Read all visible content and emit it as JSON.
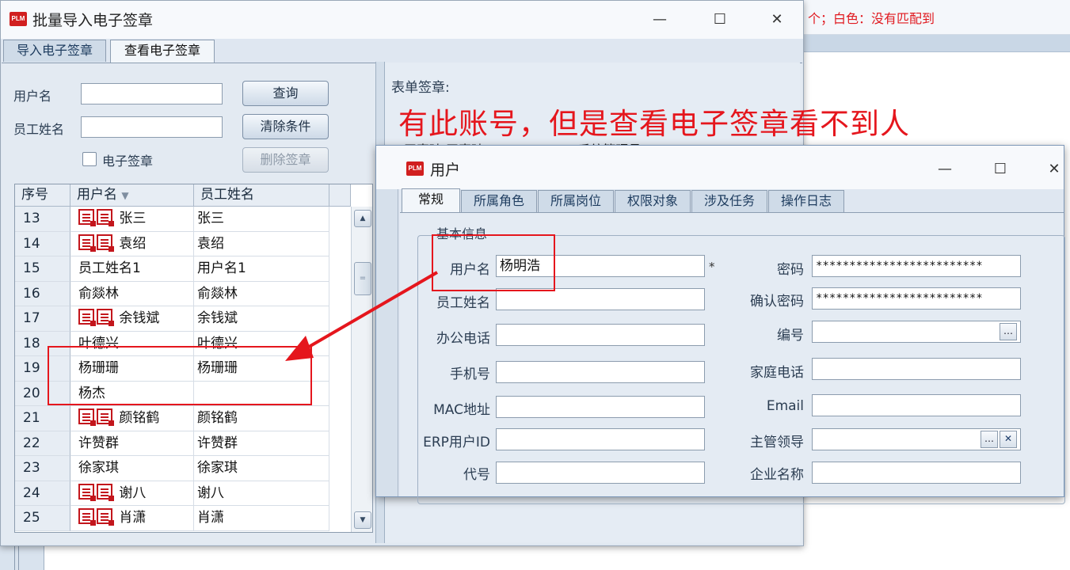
{
  "background": {
    "note": "个；白色：没有匹配到"
  },
  "main_window": {
    "title": "批量导入电子签章",
    "logo": "PLM",
    "controls": {
      "minimize": "—",
      "maximize": "☐",
      "close": "✕"
    },
    "tabs": [
      {
        "label": "导入电子签章",
        "active": false
      },
      {
        "label": "查看电子签章",
        "active": true
      }
    ],
    "filters": {
      "username_label": "用户名",
      "username_value": "",
      "employee_label": "员工姓名",
      "employee_value": "",
      "signature_checkbox_label": "电子签章"
    },
    "buttons": {
      "query": "查询",
      "clear": "清除条件",
      "delete": "删除签章"
    },
    "table": {
      "columns": [
        "序号",
        "用户名",
        "员工姓名"
      ],
      "sort_icon": "▼",
      "rows": [
        {
          "no": "13",
          "user": "张三",
          "name": "张三",
          "sig": true
        },
        {
          "no": "14",
          "user": "袁绍",
          "name": "袁绍",
          "sig": true
        },
        {
          "no": "15",
          "user": "员工姓名1",
          "name": "用户名1",
          "sig": false
        },
        {
          "no": "16",
          "user": "俞燚林",
          "name": "俞燚林",
          "sig": false
        },
        {
          "no": "17",
          "user": "余钱斌",
          "name": "余钱斌",
          "sig": true
        },
        {
          "no": "18",
          "user": "叶德兴",
          "name": "叶德兴",
          "sig": false
        },
        {
          "no": "19",
          "user": "杨珊珊",
          "name": "杨珊珊",
          "sig": false
        },
        {
          "no": "20",
          "user": "杨杰",
          "name": "",
          "sig": false
        },
        {
          "no": "21",
          "user": "颜铭鹤",
          "name": "颜铭鹤",
          "sig": true
        },
        {
          "no": "22",
          "user": "许赞群",
          "name": "许赞群",
          "sig": false
        },
        {
          "no": "23",
          "user": "徐家琪",
          "name": "徐家琪",
          "sig": false
        },
        {
          "no": "24",
          "user": "谢八",
          "name": "谢八",
          "sig": true
        },
        {
          "no": "25",
          "user": "肖潇",
          "name": "肖潇",
          "sig": true
        }
      ]
    },
    "right_panel": {
      "form_signature_label": "表单签章:",
      "annotation": "有此账号，但是查看电子签章看不到人",
      "hidden_row_text": "王喜琦    王喜琦                    administrator    系统管理员"
    }
  },
  "user_window": {
    "title": "用户",
    "logo": "PLM",
    "controls": {
      "minimize": "—",
      "maximize": "☐",
      "close": "✕"
    },
    "tabs": [
      {
        "label": "常规",
        "active": true
      },
      {
        "label": "所属角色",
        "active": false
      },
      {
        "label": "所属岗位",
        "active": false
      },
      {
        "label": "权限对象",
        "active": false
      },
      {
        "label": "涉及任务",
        "active": false
      },
      {
        "label": "操作日志",
        "active": false
      }
    ],
    "group_title": "基本信息",
    "fields": {
      "username_label": "用户名",
      "username_value": "杨明浩",
      "required_mark": "*",
      "employee_label": "员工姓名",
      "employee_value": "",
      "office_phone_label": "办公电话",
      "office_phone_value": "",
      "mobile_label": "手机号",
      "mobile_value": "",
      "mac_label": "MAC地址",
      "mac_value": "",
      "erp_label": "ERP用户ID",
      "erp_value": "",
      "code_label": "代号",
      "code_value": "",
      "password_label": "密码",
      "password_value": "*************************",
      "confirm_label": "确认密码",
      "confirm_value": "*************************",
      "number_label": "编号",
      "number_value": "",
      "home_phone_label": "家庭电话",
      "home_phone_value": "",
      "email_label": "Email",
      "email_value": "",
      "manager_label": "主管领导",
      "manager_value": "",
      "company_label": "企业名称",
      "company_value": ""
    },
    "mini_buttons": {
      "ellipsis": "…",
      "clear": "✕"
    }
  },
  "colors": {
    "annotation": "#e5161d",
    "accent": "#1e3c5f"
  }
}
